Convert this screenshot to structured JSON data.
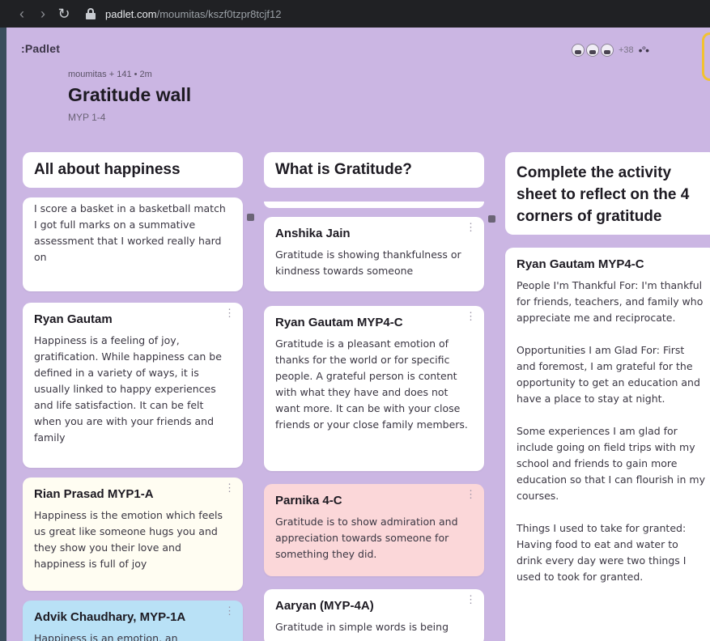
{
  "browser": {
    "back_icon": "back-arrow-icon",
    "forward_icon": "forward-arrow-icon",
    "reload_icon": "reload-icon",
    "url_host": "padlet.com",
    "url_path": "/moumitas/kszf0tzpr8tcjf12"
  },
  "header": {
    "logo": ":Padlet",
    "meta": "moumitas + 141 • 2m",
    "title": "Gratitude wall",
    "subtitle": "MYP 1-4",
    "avatar_count": "+38"
  },
  "columns": [
    {
      "title": "All about happiness",
      "cards": [
        {
          "author": "",
          "body": "I score a basket in a basketball match\nI got full marks on a summative assessment that I worked really hard on"
        },
        {
          "author": "Ryan Gautam",
          "body": "Happiness is a feeling of joy, gratification. While happiness can be defined in a variety of ways, it is usually linked to happy experiences and life satisfaction. It can be felt when you are with your friends and family"
        },
        {
          "author": "Rian Prasad MYP1-A",
          "body": "Happiness is the emotion which feels us great like someone hugs you and they show you their love and happiness is full of joy"
        },
        {
          "author": "Advik Chaudhary, MYP-1A",
          "body": "Happiness is an emotion, an"
        }
      ]
    },
    {
      "title": "What is Gratitude?",
      "cards": [
        {
          "author": "Anshika Jain",
          "body": "Gratitude is showing thankfulness or kindness towards someone"
        },
        {
          "author": "Ryan Gautam MYP4-C",
          "body": "Gratitude is a pleasant emotion of thanks for the world or for specific people. A grateful person is content with what they have and does not want more. It can be with your close friends or your close family members."
        },
        {
          "author": "Parnika 4-C",
          "body": "Gratitude is to show admiration and appreciation towards someone for something they did."
        },
        {
          "author": "Aaryan (MYP-4A)",
          "body": "Gratitude in simple words is being"
        }
      ]
    },
    {
      "title": "Complete the activity sheet to reflect on the 4 corners of gratitude",
      "cards": [
        {
          "author": "Ryan Gautam MYP4-C",
          "body": "People I'm Thankful For: I'm thankful for friends, teachers, and family who appreciate me and reciprocate.\n\nOpportunities I am Glad For: First and foremost, I am grateful for the opportunity to get an education and have a place to stay at night.\n\nSome experiences I am glad for include going on field trips with my school and friends to gain more education so that I can flourish in my courses.\n\nThings I used to take for granted: Having food to eat and water to drink every day were two things I used to took for granted."
        }
      ]
    }
  ],
  "colors": {
    "background": "#cbb6e3",
    "pink_card": "#fbd7d9",
    "cream_card": "#fffdf2",
    "blue_card": "#b9e1f6"
  }
}
